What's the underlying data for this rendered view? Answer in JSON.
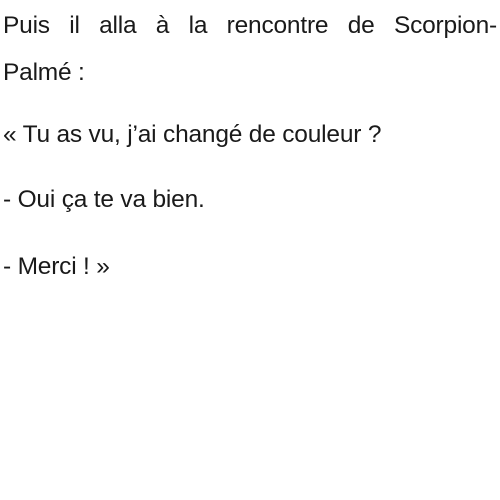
{
  "text": {
    "line1": "Puis il alla à la rencontre de Scorpion-",
    "line2": "Palmé :",
    "line3": "« Tu as vu, j’ai changé de couleur ?",
    "line4": "- Oui ça te va bien.",
    "line5": "- Merci ! »"
  }
}
